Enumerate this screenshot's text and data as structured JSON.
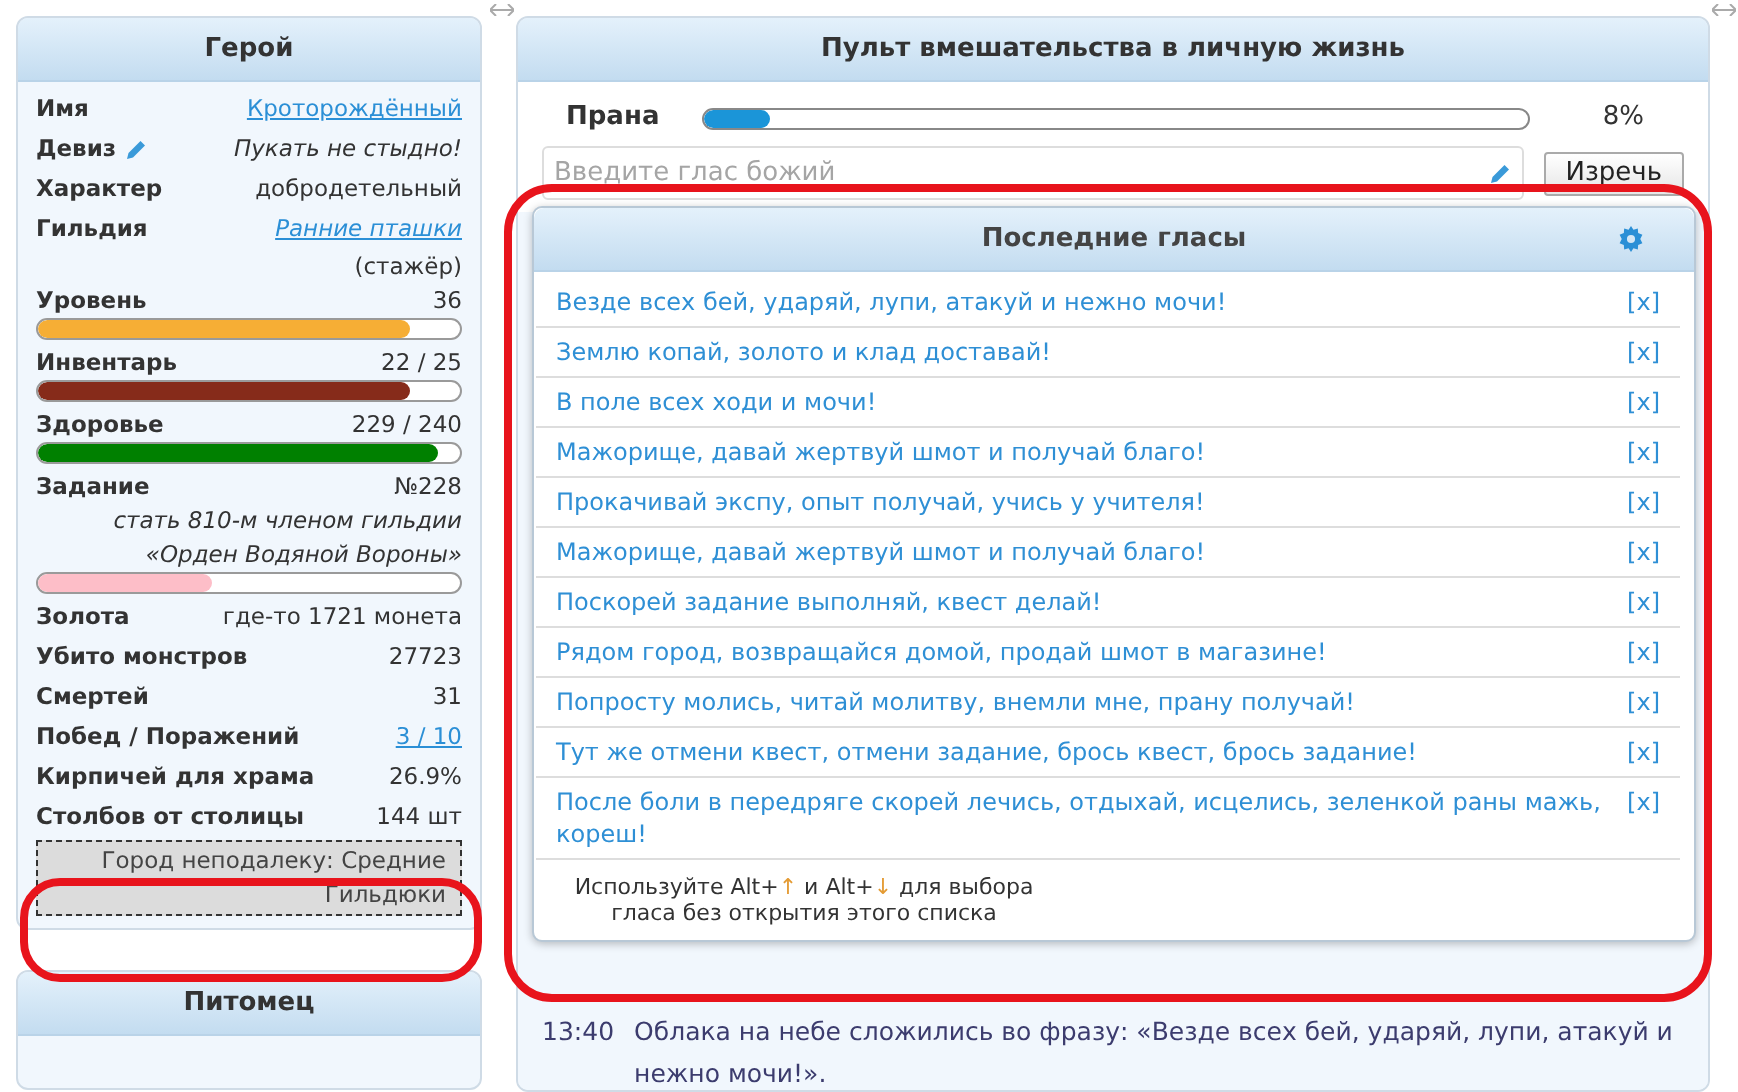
{
  "hero": {
    "title": "Герой",
    "rows": [
      {
        "kind": "link",
        "label": "Имя",
        "value": "Кроторождённый"
      },
      {
        "kind": "motto",
        "label": "Девиз",
        "value": "Пукать не стыдно!"
      },
      {
        "kind": "text",
        "label": "Характер",
        "value": "добродетельный"
      },
      {
        "kind": "guild",
        "label": "Гильдия",
        "value": "Ранние пташки",
        "rank": "(стажёр)"
      },
      {
        "kind": "bar",
        "label": "Уровень",
        "value": "36",
        "level": 0.88,
        "color": "#f6ae35"
      },
      {
        "kind": "bar",
        "label": "Инвентарь",
        "value": "22 / 25",
        "level": 0.88,
        "color": "#862b1a"
      },
      {
        "kind": "bar",
        "label": "Здоровье",
        "value": "229 / 240",
        "level": 0.95,
        "color": "#008000"
      },
      {
        "kind": "quest",
        "label": "Задание",
        "value": "№228",
        "description": [
          "стать 810-м членом гильдии",
          "«Орден Водяной Вороны»"
        ],
        "level": 0.41,
        "color": "#fdbec8"
      },
      {
        "kind": "text",
        "label": "Золота",
        "value": "где-то 1721 монета"
      },
      {
        "kind": "text",
        "label": "Убито монстров",
        "value": "27723"
      },
      {
        "kind": "text",
        "label": "Смертей",
        "value": "31"
      },
      {
        "kind": "link",
        "label": "Побед / Поражений",
        "value": "3 / 10"
      },
      {
        "kind": "text",
        "label": "Кирпичей для храма",
        "value": "26.9%"
      },
      {
        "kind": "text",
        "label": "Столбов от столицы",
        "value": "144 шт"
      }
    ],
    "town": "Город неподалеку: Средние Гильдюки"
  },
  "pet": {
    "title": "Питомец"
  },
  "control": {
    "title": "Пульт вмешательства в личную жизнь",
    "prana": {
      "label": "Прана",
      "level": 0.08,
      "reading": "8%"
    },
    "voice_input": {
      "placeholder": "Введите глас божий"
    },
    "button": "Изречь"
  },
  "log": [
    {
      "time": "13:40",
      "text": "Облака на небе сложились во фразу: «Везде всех бей, ударяй, лупи, атакуй и нежно мочи!»."
    }
  ],
  "dropdown": {
    "title": "Последние гласы",
    "items": [
      {
        "text": "Везде всех бей, ударяй, лупи, атакуй и нежно мочи!",
        "remove": "[x]"
      },
      {
        "text": "Землю копай, золото и клад доставай!",
        "remove": "[x]"
      },
      {
        "text": "В поле всех ходи и мочи!",
        "remove": "[x]"
      },
      {
        "text": "Мажорище, давай жертвуй шмот и получай благо!",
        "remove": "[x]"
      },
      {
        "text": "Прокачивай экспу, опыт получай, учись у учителя!",
        "remove": "[x]"
      },
      {
        "text": "Мажорище, давай жертвуй шмот и получай благо!",
        "remove": "[x]"
      },
      {
        "text": "Поскорей задание выполняй, квест делай!",
        "remove": "[x]"
      },
      {
        "text": "Рядом город, возвращайся домой, продай шмот в магазине!",
        "remove": "[x]"
      },
      {
        "text": "Попросту молись, читай молитву, внемли мне, прану получай!",
        "remove": "[x]"
      },
      {
        "text": "Тут же отмени квест, отмени задание, брось квест, брось задание!",
        "remove": "[x]"
      },
      {
        "text": "После боли в передряге скорей лечись, отдыхай, исцелись, зеленкой раны мажь, кореш!",
        "remove": "[x]"
      }
    ],
    "hint": [
      {
        "kind": "plain",
        "text": "Используйте Alt+"
      },
      {
        "kind": "key",
        "text": "↑"
      },
      {
        "kind": "plain",
        "text": " и Alt+"
      },
      {
        "kind": "key",
        "text": "↓"
      },
      {
        "kind": "plain",
        "text": " для выбора гласа без открытия этого списка"
      }
    ]
  }
}
